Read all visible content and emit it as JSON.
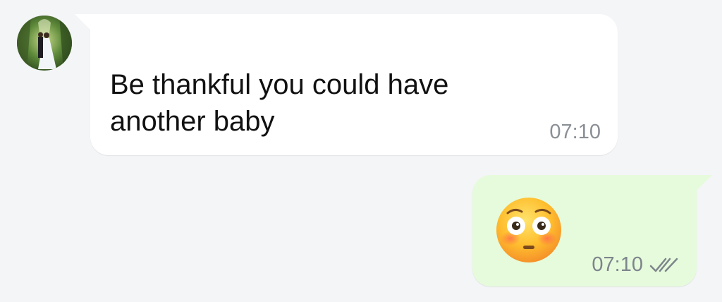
{
  "messages": [
    {
      "direction": "incoming",
      "sender": "",
      "text": "Be thankful you could have another baby",
      "time": "07:10",
      "avatar_icon": "profile-photo-icon"
    },
    {
      "direction": "outgoing",
      "emoji": "flushed-face-emoji",
      "time": "07:10",
      "status_icon": "double-check-icon",
      "status": "read"
    }
  ],
  "colors": {
    "background": "#f4f5f7",
    "incoming_bubble": "#ffffff",
    "outgoing_bubble": "#e6fbdc",
    "timestamp": "#8a8f95",
    "message_text": "#111111"
  }
}
